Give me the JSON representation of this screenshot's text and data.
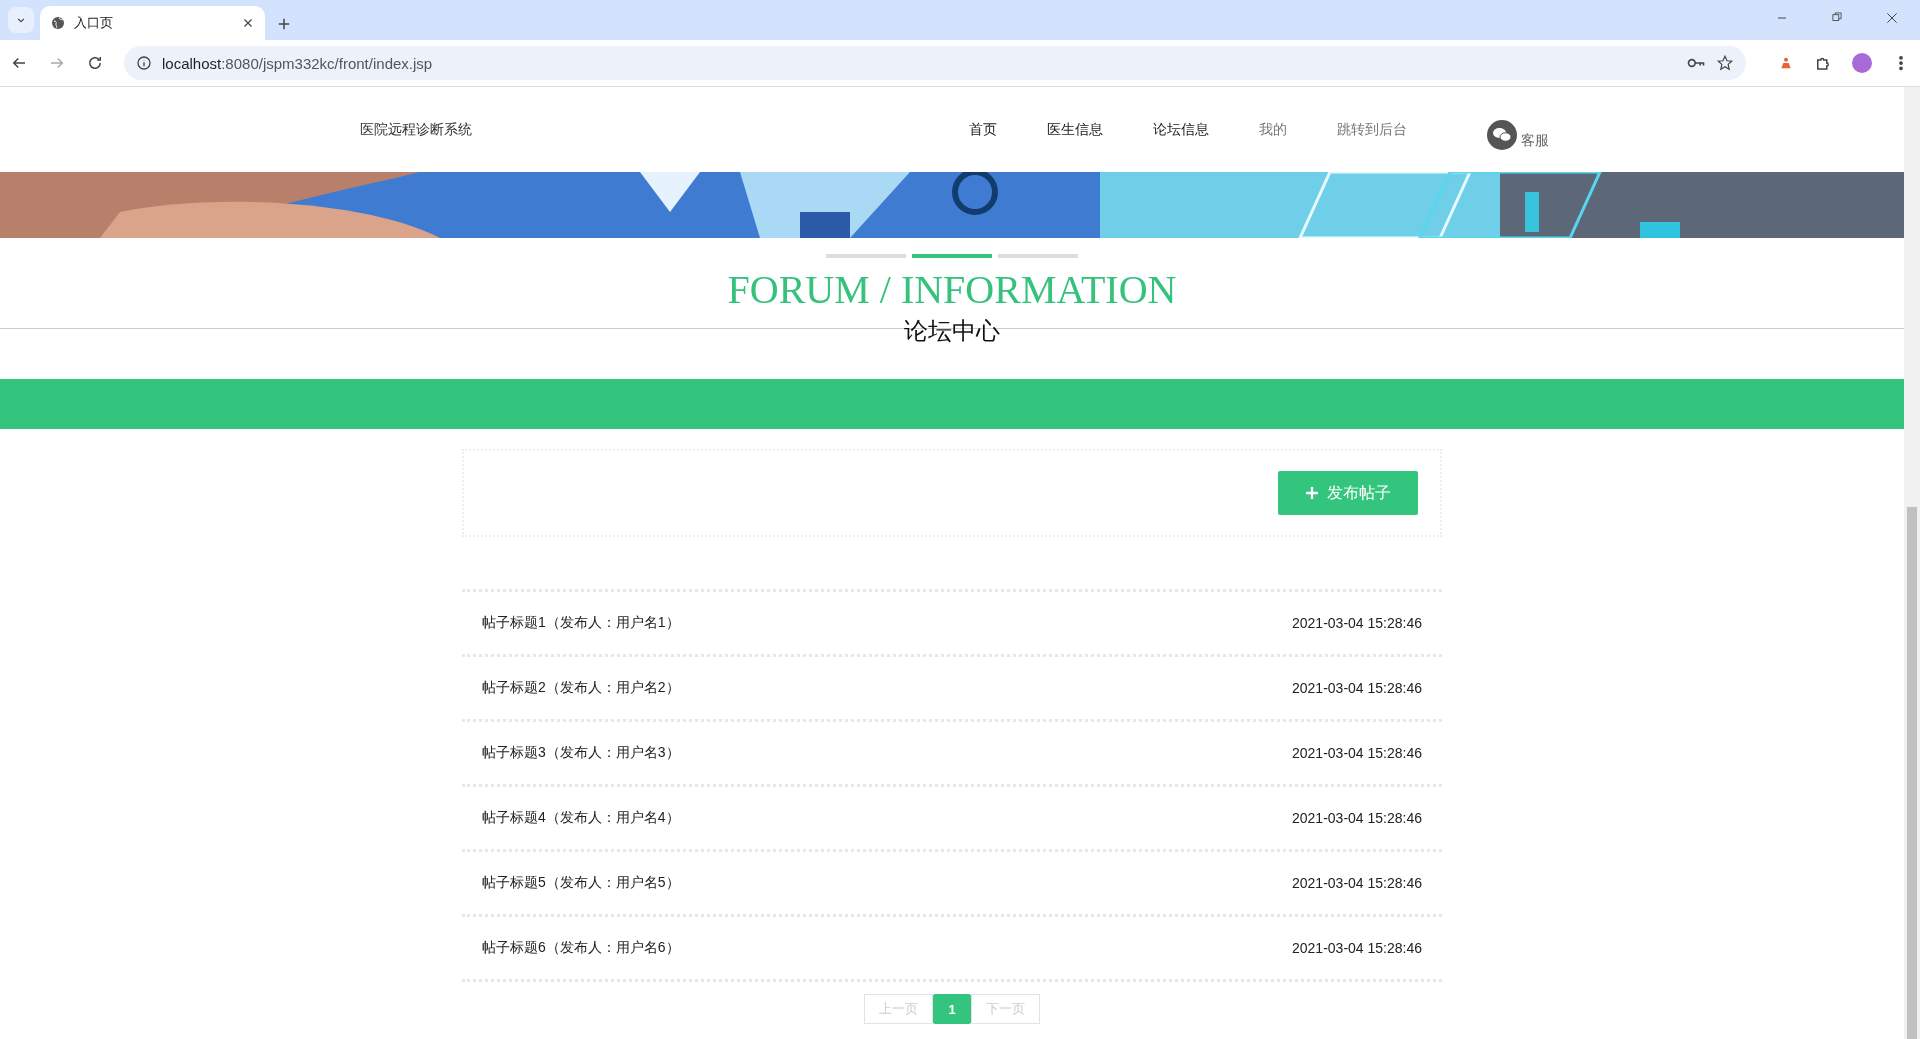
{
  "browser": {
    "tab_title": "入口页",
    "url_host": "localhost",
    "url_rest": ":8080/jspm332kc/front/index.jsp"
  },
  "site": {
    "title": "医院远程诊断系统",
    "nav": [
      {
        "label": "首页",
        "dimmed": false
      },
      {
        "label": "医生信息",
        "dimmed": false
      },
      {
        "label": "论坛信息",
        "dimmed": false
      },
      {
        "label": "我的",
        "dimmed": true
      },
      {
        "label": "跳转到后台",
        "dimmed": true
      }
    ],
    "service": "客服"
  },
  "banner": {
    "kind": "picture",
    "dots": [
      {
        "selected": false
      },
      {
        "selected": true
      },
      {
        "selected": false
      }
    ]
  },
  "section": {
    "title": "FORUM / INFORMATION",
    "subtitle": "论坛中心"
  },
  "toolbar": {
    "button": "发布帖子"
  },
  "posts": [
    {
      "title": "帖子标题1（发布人：用户名1）",
      "time": "2021-03-04 15:28:46"
    },
    {
      "title": "帖子标题2（发布人：用户名2）",
      "time": "2021-03-04 15:28:46"
    },
    {
      "title": "帖子标题3（发布人：用户名3）",
      "time": "2021-03-04 15:28:46"
    },
    {
      "title": "帖子标题4（发布人：用户名4）",
      "time": "2021-03-04 15:28:46"
    },
    {
      "title": "帖子标题5（发布人：用户名5）",
      "time": "2021-03-04 15:28:46"
    },
    {
      "title": "帖子标题6（发布人：用户名6）",
      "time": "2021-03-04 15:28:46"
    }
  ],
  "pagination": {
    "prev": {
      "label": "上一页",
      "disabled": true
    },
    "pages": [
      {
        "label": "1",
        "selected": true
      }
    ],
    "next": {
      "label": "下一页",
      "disabled": true
    }
  }
}
